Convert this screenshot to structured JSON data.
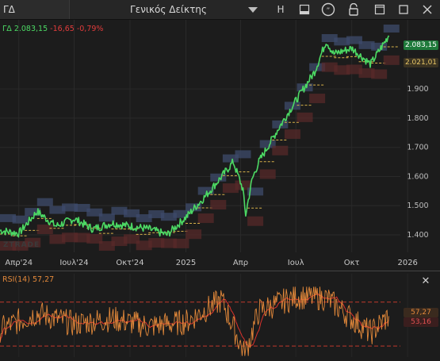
{
  "toolbar": {
    "symbol": "ΓΔ",
    "name": "Γενικός Δείκτης",
    "interval_label": "H"
  },
  "legend": {
    "symbol": "ΓΔ",
    "last": "2.083,15",
    "change": "-16,65",
    "change_pct": "-0,79%"
  },
  "price_labels": {
    "last": "2.083,15",
    "level": "2.021,01"
  },
  "rsi": {
    "label": "RSI(14)",
    "value": "57,27",
    "value_box": "57,27",
    "ma_box": "53,16"
  },
  "watermark": "ZTRADE",
  "colors": {
    "background": "#1c1c1c",
    "price_line": "#4cd964",
    "negative": "#e03c3c",
    "rsi_line": "#e2883a",
    "rsi_ma": "#d9322c",
    "upper_zone": "#3d4b6b",
    "lower_zone": "#5a2a2a",
    "level_line": "#d8b24a"
  },
  "icons": [
    "chevron-down-icon",
    "bar-style-icon",
    "quote-icon",
    "lock-icon",
    "fullscreen-icon",
    "window-icon",
    "close-icon"
  ],
  "chart_data": [
    {
      "type": "line",
      "title": "ΓΔ",
      "x_ticks": [
        "Απρ'24",
        "Ιουλ'24",
        "Οκτ'24",
        "2025",
        "Απρ",
        "Ιουλ",
        "Οκτ",
        "2026"
      ],
      "y_ticks": [
        "1.400",
        "1.500",
        "1.600",
        "1.700",
        "1.800",
        "1.900"
      ],
      "ylim": [
        1340,
        2110
      ],
      "grid": true,
      "x": [
        "2024-03-01",
        "2024-04-01",
        "2024-05-01",
        "2024-06-01",
        "2024-07-01",
        "2024-08-01",
        "2024-09-01",
        "2024-10-01",
        "2024-11-01",
        "2024-12-01",
        "2025-01-01",
        "2025-02-01",
        "2025-03-01",
        "2025-03-20",
        "2025-04-05",
        "2025-04-09",
        "2025-04-20",
        "2025-05-01",
        "2025-06-01",
        "2025-07-01",
        "2025-08-01",
        "2025-08-20",
        "2025-09-01",
        "2025-10-01",
        "2025-11-01",
        "2025-12-01"
      ],
      "series": [
        {
          "values": [
            1415,
            1405,
            1480,
            1430,
            1455,
            1420,
            1440,
            1430,
            1420,
            1400,
            1460,
            1530,
            1600,
            1650,
            1555,
            1465,
            1590,
            1650,
            1760,
            1860,
            1960,
            2065,
            2020,
            2040,
            1985,
            2083
          ]
        }
      ]
    },
    {
      "type": "line",
      "title": "RSI(14)",
      "ylim": [
        20,
        85
      ],
      "levels": [
        70,
        30
      ],
      "x": [
        "2024-03-01",
        "2024-05-01",
        "2024-07-01",
        "2024-09-01",
        "2024-11-01",
        "2025-01-01",
        "2025-03-01",
        "2025-04-08",
        "2025-05-01",
        "2025-07-01",
        "2025-08-20",
        "2025-10-01",
        "2025-11-01",
        "2025-12-01"
      ],
      "series": [
        {
          "values": [
            45,
            60,
            50,
            55,
            48,
            52,
            72,
            22,
            62,
            75,
            74,
            55,
            42,
            57.27
          ]
        }
      ]
    }
  ]
}
